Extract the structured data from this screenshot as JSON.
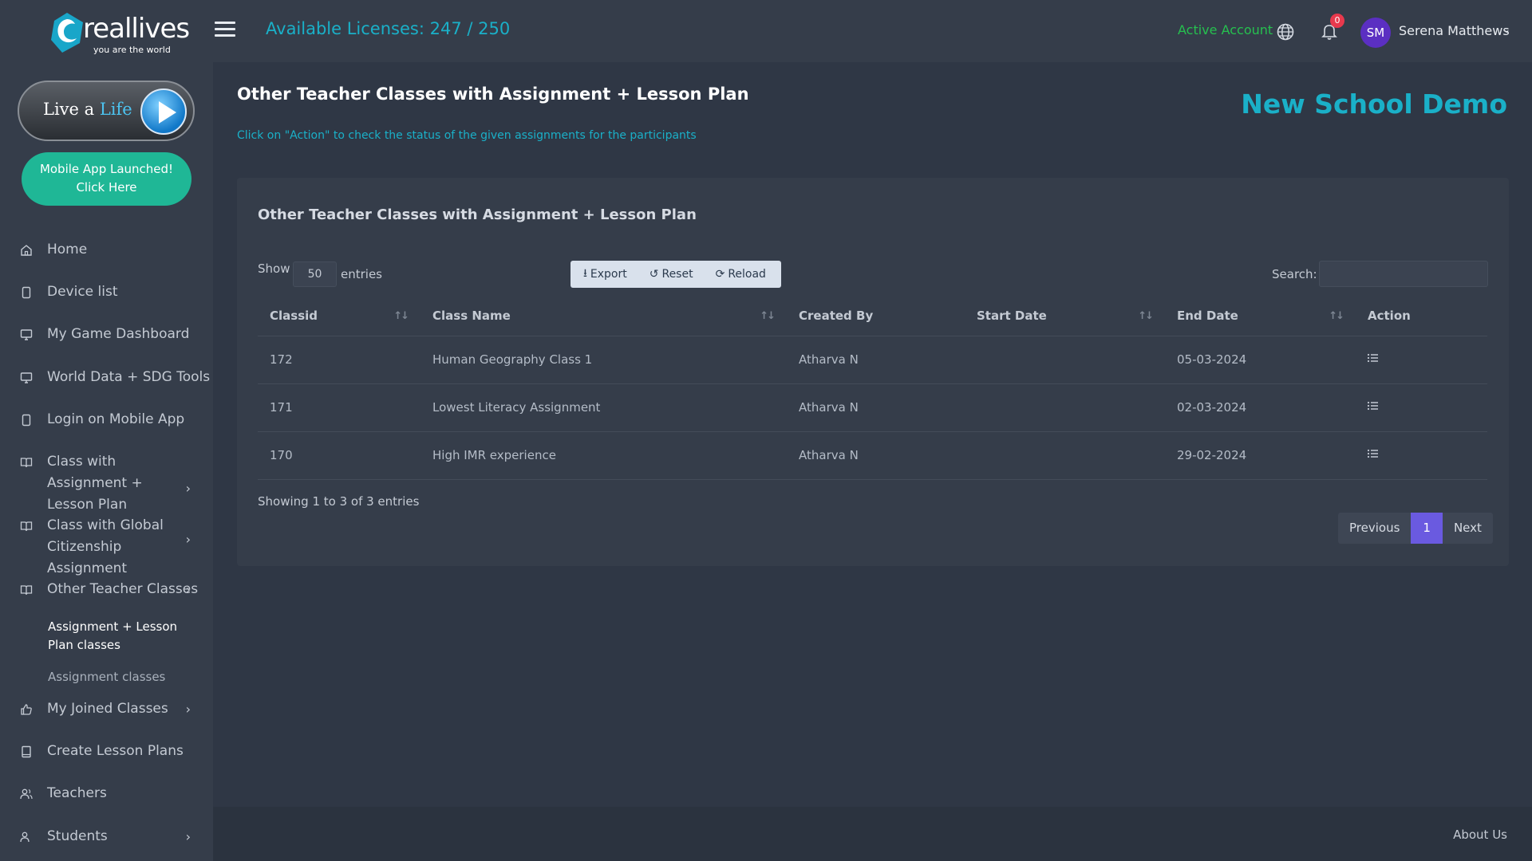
{
  "brand": {
    "name": "reallives",
    "tagline": "you are the world"
  },
  "promo": {
    "live_prefix": "Live a",
    "live_suffix": "Life",
    "mobile_line1": "Mobile App Launched!",
    "mobile_line2": "Click Here"
  },
  "sidebar": {
    "items": [
      {
        "label": "Home",
        "icon": "home-icon"
      },
      {
        "label": "Device list",
        "icon": "device-icon"
      },
      {
        "label": "My Game Dashboard",
        "icon": "monitor-icon"
      },
      {
        "label": "World Data + SDG Tools",
        "icon": "monitor-icon"
      },
      {
        "label": "Login on Mobile App",
        "icon": "mobile-icon"
      },
      {
        "label": "Class with Assignment + Lesson Plan",
        "icon": "book-icon"
      },
      {
        "label": "Class with Global Citizenship Assignment",
        "icon": "book-icon"
      },
      {
        "label": "Other Teacher Classes",
        "icon": "book-icon"
      },
      {
        "label": "My Joined Classes",
        "icon": "thumbs-up-icon"
      },
      {
        "label": "Create Lesson Plans",
        "icon": "book-icon"
      },
      {
        "label": "Teachers",
        "icon": "users-icon"
      },
      {
        "label": "Students",
        "icon": "users-icon"
      }
    ],
    "subitems": [
      {
        "label": "Assignment + Lesson Plan classes",
        "active": true
      },
      {
        "label": "Assignment classes",
        "active": false
      }
    ]
  },
  "header": {
    "licenses": "Available Licenses: 247 / 250",
    "account_status": "Active Account",
    "notification_count": "0",
    "avatar_initials": "SM",
    "user_name": "Serena Matthews"
  },
  "page": {
    "title": "Other Teacher Classes with Assignment + Lesson Plan",
    "school": "New School Demo",
    "hint": "Click on \"Action\" to check the status of the given assignments for the participants"
  },
  "card": {
    "title": "Other Teacher Classes with Assignment + Lesson Plan",
    "show_label": "Show",
    "page_size": "50",
    "entries_label": "entries",
    "buttons": {
      "export": "Export",
      "reset": "Reset",
      "reload": "Reload"
    },
    "search_label": "Search:",
    "search_value": "",
    "columns": [
      "Classid",
      "Class Name",
      "Created By",
      "Start Date",
      "End Date",
      "Action"
    ],
    "rows": [
      {
        "classid": "172",
        "name": "Human Geography Class 1",
        "created_by": "Atharva N",
        "start": "",
        "end": "05-03-2024"
      },
      {
        "classid": "171",
        "name": "Lowest Literacy Assignment",
        "created_by": "Atharva N",
        "start": "",
        "end": "02-03-2024"
      },
      {
        "classid": "170",
        "name": "High IMR experience",
        "created_by": "Atharva N",
        "start": "",
        "end": "29-02-2024"
      }
    ],
    "showing": "Showing 1 to 3 of 3 entries",
    "pager": {
      "previous": "Previous",
      "current": "1",
      "next": "Next"
    }
  },
  "footer": {
    "about": "About Us"
  },
  "colors": {
    "accent": "#1ab0c8",
    "success": "#26c04f",
    "primary": "#6a5ae0",
    "mobile_button": "#1fb796",
    "badge": "#e8394d"
  }
}
